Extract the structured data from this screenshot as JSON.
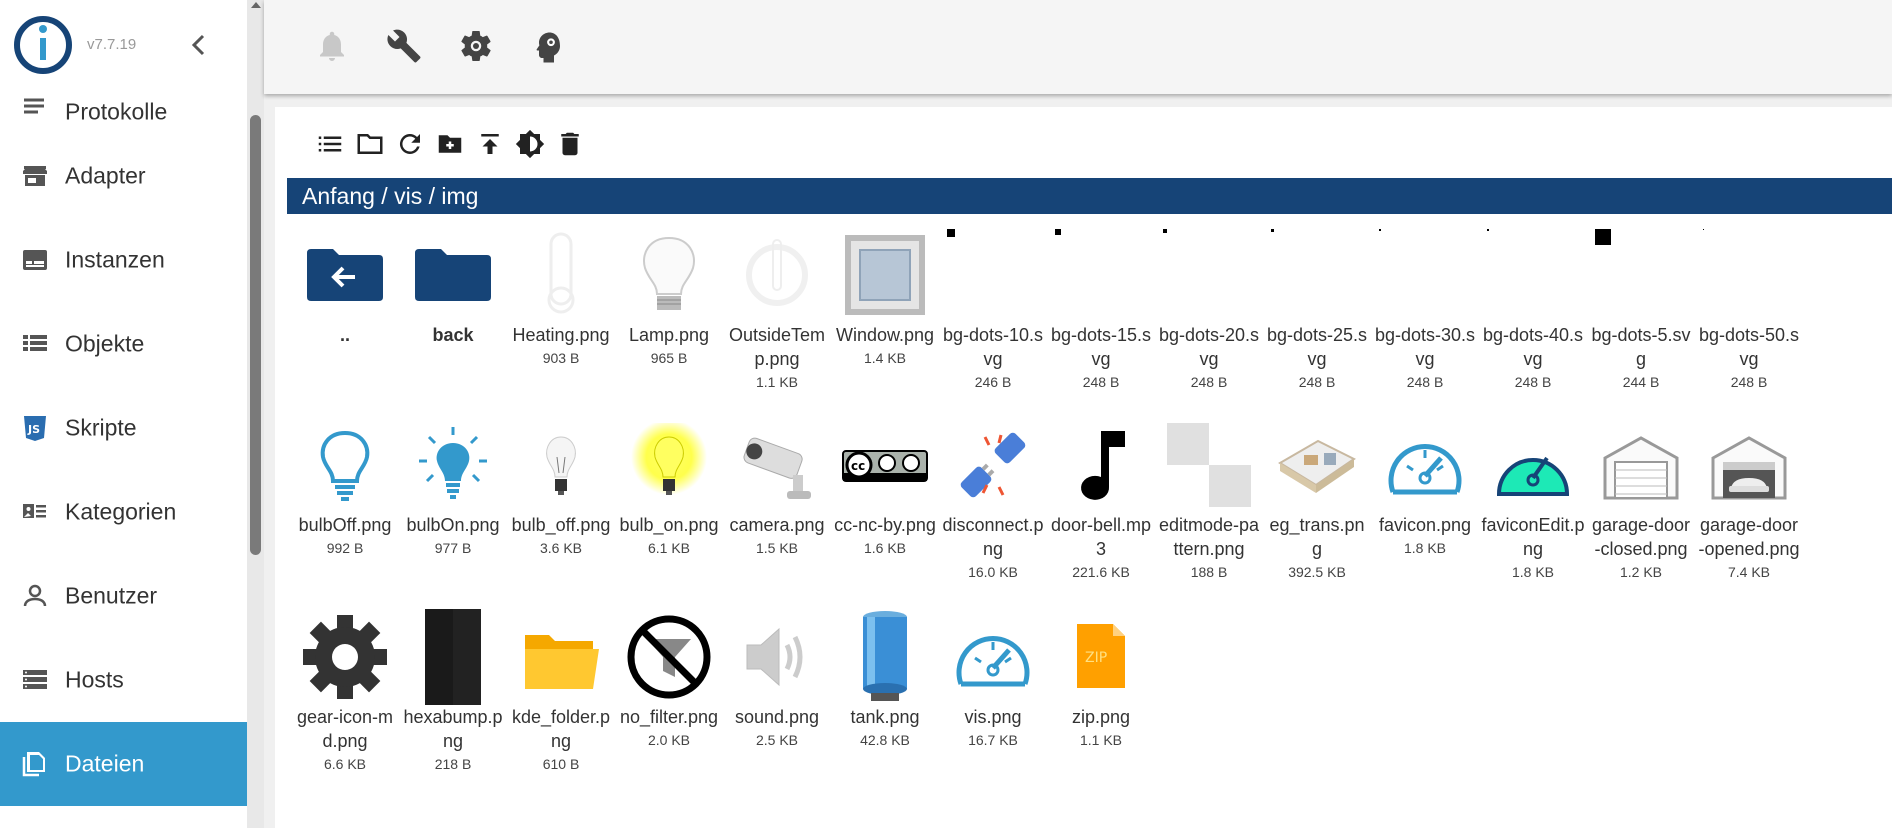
{
  "app": {
    "version": "v7.7.19"
  },
  "sidebar": {
    "items": [
      {
        "label": "Protokolle",
        "icon": "list-icon"
      },
      {
        "label": "Adapter",
        "icon": "store-icon"
      },
      {
        "label": "Instanzen",
        "icon": "instances-icon"
      },
      {
        "label": "Objekte",
        "icon": "objects-list-icon"
      },
      {
        "label": "Skripte",
        "icon": "js-icon"
      },
      {
        "label": "Kategorien",
        "icon": "categories-icon"
      },
      {
        "label": "Benutzer",
        "icon": "user-icon"
      },
      {
        "label": "Hosts",
        "icon": "hosts-icon"
      },
      {
        "label": "Dateien",
        "icon": "files-icon"
      }
    ],
    "active": "Dateien"
  },
  "breadcrumb": {
    "root": "Anfang",
    "sep": " / ",
    "p1": "vis",
    "p2": "img"
  },
  "files": [
    {
      "name": "..",
      "size": "",
      "kind": "back"
    },
    {
      "name": "back",
      "size": "",
      "kind": "folder"
    },
    {
      "name": "Heating.png",
      "size": "903 B",
      "kind": "heating"
    },
    {
      "name": "Lamp.png",
      "size": "965 B",
      "kind": "lamp"
    },
    {
      "name": "OutsideTemp.png",
      "size": "1.1 KB",
      "kind": "outside"
    },
    {
      "name": "Window.png",
      "size": "1.4 KB",
      "kind": "window"
    },
    {
      "name": "bg-dots-10.svg",
      "size": "246 B",
      "kind": "dot",
      "dot": 8
    },
    {
      "name": "bg-dots-15.svg",
      "size": "248 B",
      "kind": "dot",
      "dot": 6
    },
    {
      "name": "bg-dots-20.svg",
      "size": "248 B",
      "kind": "dot",
      "dot": 4
    },
    {
      "name": "bg-dots-25.svg",
      "size": "248 B",
      "kind": "dot",
      "dot": 3
    },
    {
      "name": "bg-dots-30.svg",
      "size": "248 B",
      "kind": "dot",
      "dot": 2
    },
    {
      "name": "bg-dots-40.svg",
      "size": "248 B",
      "kind": "dot",
      "dot": 2
    },
    {
      "name": "bg-dots-5.svg",
      "size": "244 B",
      "kind": "dot",
      "dot": 16
    },
    {
      "name": "bg-dots-50.svg",
      "size": "248 B",
      "kind": "dot",
      "dot": 1
    },
    {
      "name": "bulbOff.png",
      "size": "992 B",
      "kind": "bulbOff"
    },
    {
      "name": "bulbOn.png",
      "size": "977 B",
      "kind": "bulbOn"
    },
    {
      "name": "bulb_off.png",
      "size": "3.6 KB",
      "kind": "bulb_off"
    },
    {
      "name": "bulb_on.png",
      "size": "6.1 KB",
      "kind": "bulb_on"
    },
    {
      "name": "camera.png",
      "size": "1.5 KB",
      "kind": "camera"
    },
    {
      "name": "cc-nc-by.png",
      "size": "1.6 KB",
      "kind": "cc"
    },
    {
      "name": "disconnect.png",
      "size": "16.0 KB",
      "kind": "disconnect"
    },
    {
      "name": "door-bell.mp3",
      "size": "221.6 KB",
      "kind": "note"
    },
    {
      "name": "editmode-pattern.png",
      "size": "188 B",
      "kind": "pattern"
    },
    {
      "name": "eg_trans.png",
      "size": "392.5 KB",
      "kind": "floor"
    },
    {
      "name": "favicon.png",
      "size": "1.8 KB",
      "kind": "favicon"
    },
    {
      "name": "faviconEdit.png",
      "size": "1.8 KB",
      "kind": "faviconEdit"
    },
    {
      "name": "garage-door-closed.png",
      "size": "1.2 KB",
      "kind": "garageClosed"
    },
    {
      "name": "garage-door-opened.png",
      "size": "7.4 KB",
      "kind": "garageOpen"
    },
    {
      "name": "gear-icon-md.png",
      "size": "6.6 KB",
      "kind": "gear"
    },
    {
      "name": "hexabump.png",
      "size": "218 B",
      "kind": "hexa"
    },
    {
      "name": "kde_folder.png",
      "size": "610 B",
      "kind": "kdefolder"
    },
    {
      "name": "no_filter.png",
      "size": "2.0 KB",
      "kind": "nofilter"
    },
    {
      "name": "sound.png",
      "size": "2.5 KB",
      "kind": "sound"
    },
    {
      "name": "tank.png",
      "size": "42.8 KB",
      "kind": "tank"
    },
    {
      "name": "vis.png",
      "size": "16.7 KB",
      "kind": "vis"
    },
    {
      "name": "zip.png",
      "size": "1.1 KB",
      "kind": "zip"
    }
  ]
}
